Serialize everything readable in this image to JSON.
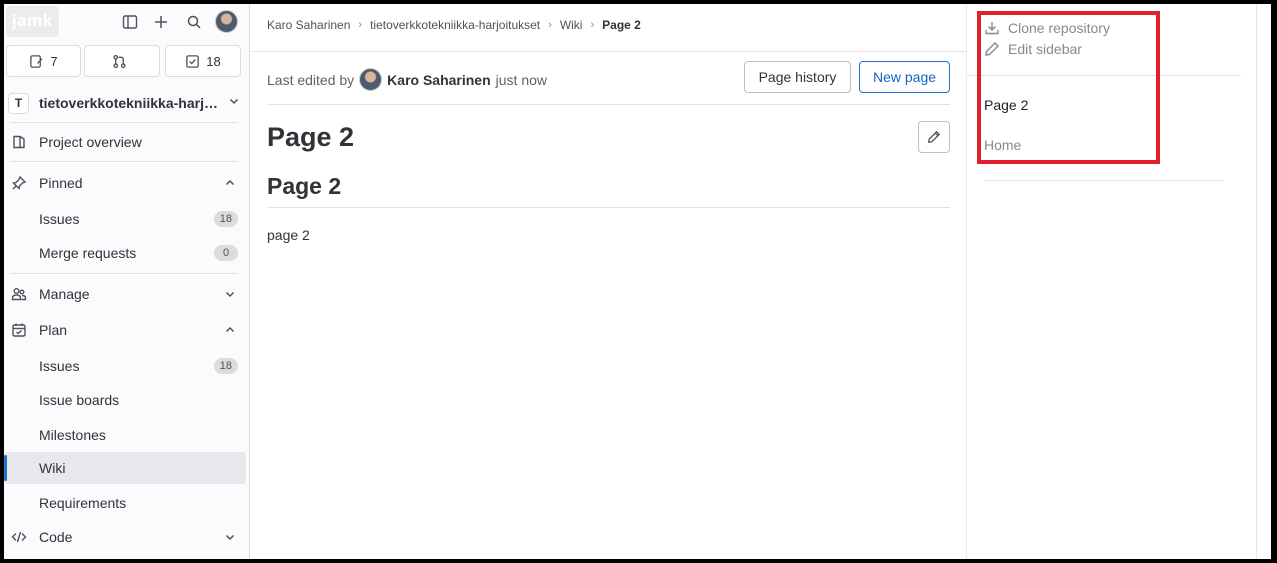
{
  "app": {
    "logo_text": "jamk"
  },
  "sidebar": {
    "counts": {
      "issues": "7",
      "merge_requests": "",
      "todos": "18"
    },
    "project_initial": "T",
    "project_name": "tietoverkkotekniikka-harjoitukset",
    "items": {
      "project_overview": "Project overview",
      "pinned": "Pinned",
      "pinned_issues": "Issues",
      "pinned_issues_count": "18",
      "pinned_mr": "Merge requests",
      "pinned_mr_count": "0",
      "manage": "Manage",
      "plan": "Plan",
      "plan_issues": "Issues",
      "plan_issues_count": "18",
      "issue_boards": "Issue boards",
      "milestones": "Milestones",
      "wiki": "Wiki",
      "requirements": "Requirements",
      "code": "Code"
    }
  },
  "breadcrumb": {
    "user": "Karo Saharinen",
    "project": "tietoverkkotekniikka-harjoitukset",
    "section": "Wiki",
    "current": "Page 2"
  },
  "page": {
    "last_edited_prefix": "Last edited by",
    "author": "Karo Saharinen",
    "time": "just now",
    "page_history_label": "Page history",
    "new_page_label": "New page",
    "title": "Page 2",
    "heading": "Page 2",
    "content": "page 2"
  },
  "right_panel": {
    "clone_repository": "Clone repository",
    "edit_sidebar": "Edit sidebar",
    "pages": [
      "Page 2",
      "Home"
    ]
  },
  "colors": {
    "accent": "#1f75cb",
    "highlight": "#e0202e"
  }
}
